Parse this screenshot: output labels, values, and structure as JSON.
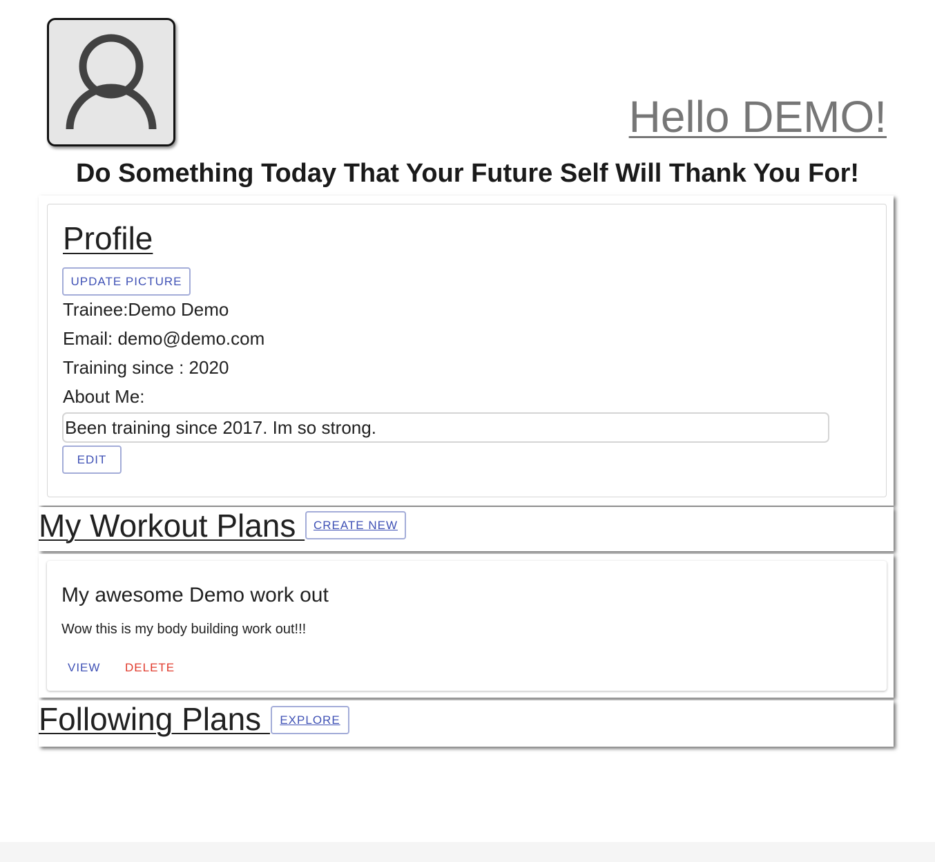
{
  "header": {
    "greeting": "Hello DEMO!",
    "motto": "Do Something Today That Your Future Self Will Thank You For!"
  },
  "profile": {
    "title": "Profile",
    "update_picture_label": "UPDATE PICTURE",
    "trainee_line": "Trainee:Demo Demo",
    "email_line": "Email: demo@demo.com",
    "training_since_line": "Training since : 2020",
    "about_label": "About Me:",
    "about_text": "Been training since 2017. Im so strong.",
    "edit_label": "EDIT"
  },
  "workout_plans": {
    "title": "My Workout Plans ",
    "create_label": "CREATE NEW",
    "plans": [
      {
        "title": "My awesome Demo work out",
        "description": "Wow this is my body building work out!!!",
        "view_label": "VIEW",
        "delete_label": "DELETE"
      }
    ]
  },
  "following_plans": {
    "title": "Following Plans ",
    "explore_label": "EXPLORE"
  },
  "icons": {
    "avatar": "user-silhouette-icon"
  },
  "colors": {
    "primary": "#3f51b5",
    "danger": "#e0392b",
    "greeting": "#767676"
  }
}
